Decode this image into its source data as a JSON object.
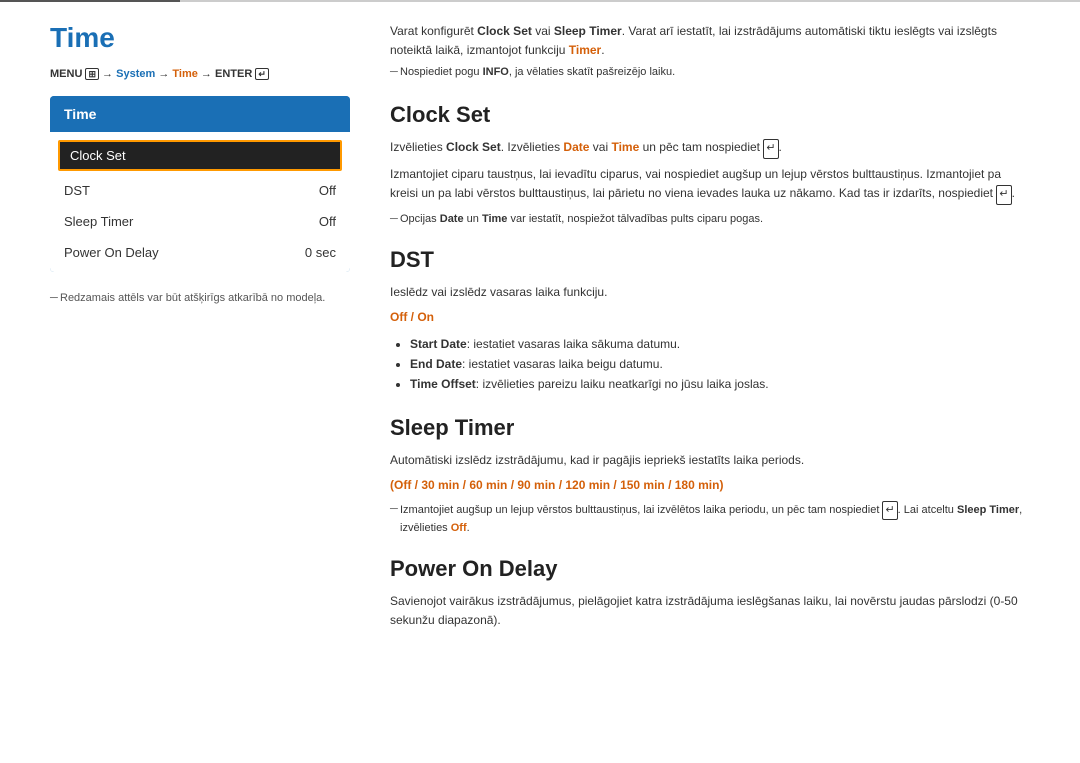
{
  "page": {
    "title": "Time",
    "top_divider": true
  },
  "menu_path": {
    "text": "MENU  → System → Time → ENTER"
  },
  "menu_box": {
    "title": "Time",
    "items": [
      {
        "label": "Clock Set",
        "value": "",
        "selected": true
      },
      {
        "label": "DST",
        "value": "Off",
        "selected": false
      },
      {
        "label": "Sleep Timer",
        "value": "Off",
        "selected": false
      },
      {
        "label": "Power On Delay",
        "value": "0 sec",
        "selected": false
      }
    ]
  },
  "left_footnote": "Redzamais attēls var būt atšķirīgs atkarībā no modeļa.",
  "intro": {
    "main_text": "Varat konfigurēt Clock Set vai Sleep Timer. Varat arī iestatīt, lai izstrādājums automātiski tiktu ieslēgts vai izslēgts noteiktā laikā, izmantojot funkciju Timer.",
    "note": "Nospiediet pogu INFO, ja vēlaties skatīt pašreizējo laiku."
  },
  "sections": [
    {
      "id": "clock-set",
      "title": "Clock Set",
      "paragraphs": [
        "Izvēlieties Clock Set. Izvēlieties Date vai Time un pēc tam nospiediet ↵.",
        "Izmantojiet ciparu taustņus, lai ievadītu ciparus, vai nospiediet augšup un lejup vērstos bulttaustiņus. Izmantojiet pa kreisi un pa labi vērstos bulttaustiņus, lai pārietu no viena ievades lauka uz nākamo. Kad tas ir izdarīts, nospiediet ↵."
      ],
      "note": "Opcijas Date un Time var iestatīt, nospiežot tālvadības pults ciparu pogas."
    },
    {
      "id": "dst",
      "title": "DST",
      "paragraphs": [
        "Ieslēdz vai izslēdz vasaras laika funkciju."
      ],
      "orange_line": "Off / On",
      "bullets": [
        {
          "term": "Start Date",
          "text": ": iestatiet vasaras laika sākuma datumu."
        },
        {
          "term": "End Date",
          "text": ": iestatiet vasaras laika beigu datumu."
        },
        {
          "term": "Time Offset",
          "text": ": izvēlieties pareizu laiku neatkarīgi no jūsu laika joslas."
        }
      ]
    },
    {
      "id": "sleep-timer",
      "title": "Sleep Timer",
      "paragraphs": [
        "Automātiski izslēdz izstrādājumu, kad ir pagājis iepriekš iestatīts laika periods."
      ],
      "orange_options": "(Off / 30 min / 60 min / 90 min / 120 min / 150 min / 180 min)",
      "note": "Izmantojiet augšup un lejup vērstos bulttaustiņus, lai izvēlētos laika periodu, un pēc tam nospiediet ↵. Lai atceltu Sleep Timer, izvēlieties Off."
    },
    {
      "id": "power-on-delay",
      "title": "Power On Delay",
      "paragraphs": [
        "Savienojot vairākus izstrādājumus, pielāgojiet katra izstrādājuma ieslēgšanas laiku, lai novērstu jaudas pārslodzi (0-50 sekunžu diapazonā)."
      ]
    }
  ]
}
